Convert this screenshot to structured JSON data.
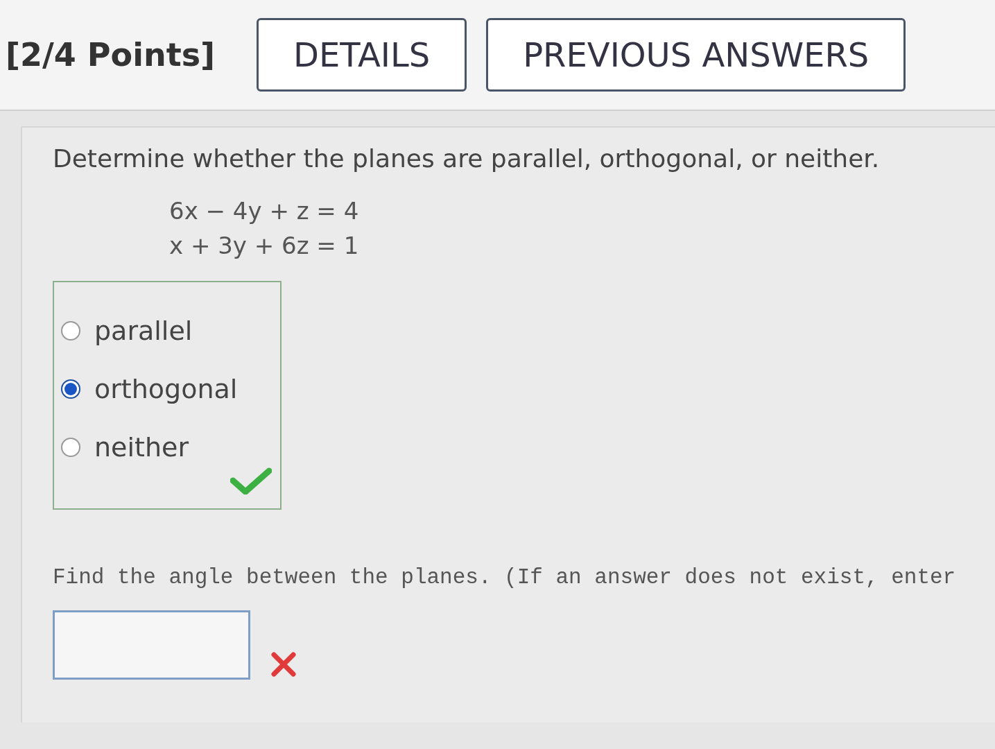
{
  "header": {
    "points": "[2/4 Points]",
    "buttons": [
      "DETAILS",
      "PREVIOUS ANSWERS"
    ]
  },
  "question": {
    "prompt": "Determine whether the planes are parallel, orthogonal, or neither.",
    "equations": [
      "6x − 4y + z = 4",
      "x + 3y + 6z = 1"
    ],
    "options": [
      {
        "label": "parallel",
        "selected": false
      },
      {
        "label": "orthogonal",
        "selected": true
      },
      {
        "label": "neither",
        "selected": false
      }
    ],
    "correct": true
  },
  "part2": {
    "prompt": "Find the angle between the planes. (If an answer does not exist, enter",
    "answer": {
      "correct": false
    }
  }
}
